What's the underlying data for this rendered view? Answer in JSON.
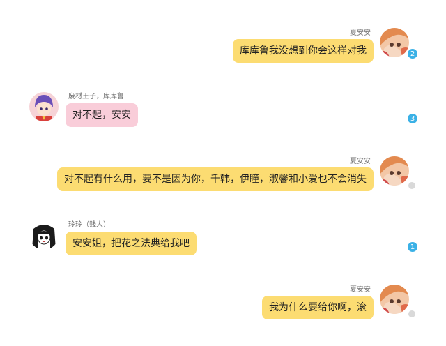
{
  "messages": [
    {
      "side": "right",
      "sender": "夏安安",
      "text": "库库鲁我没想到你会这样对我",
      "badge": "2",
      "badge_status": "unread"
    },
    {
      "side": "left",
      "sender": "废材王子，库库鲁",
      "text": "对不起，安安",
      "badge": "3",
      "badge_status": "unread"
    },
    {
      "side": "right",
      "sender": "夏安安",
      "text": "对不起有什么用，要不是因为你，千韩，伊瞳，淑馨和小爱也不会消失",
      "badge": "",
      "badge_status": "read"
    },
    {
      "side": "left",
      "sender": "玲玲（贱人）",
      "text": "安安姐，把花之法典给我吧",
      "badge": "1",
      "badge_status": "unread"
    },
    {
      "side": "right",
      "sender": "夏安安",
      "text": "我为什么要给你啊，滚",
      "badge": "",
      "badge_status": "read"
    }
  ],
  "colors": {
    "yellow_bubble": "#fcdc72",
    "pink_bubble": "#f9cdd9",
    "badge_blue": "#3bb1e6",
    "badge_gray": "#d9d9d9"
  },
  "icons": {
    "anan_avatar": "anan-avatar-icon",
    "kukulu_avatar": "kukulu-avatar-icon",
    "lingling_avatar": "lingling-avatar-icon"
  }
}
